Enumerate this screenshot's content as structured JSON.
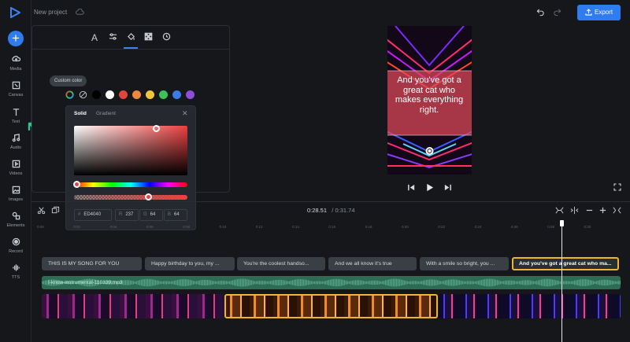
{
  "header": {
    "project_title": "New project",
    "export_label": "Export"
  },
  "rail": {
    "items": [
      {
        "label": "Media",
        "icon": "media-icon"
      },
      {
        "label": "Canvas",
        "icon": "canvas-icon"
      },
      {
        "label": "Text",
        "icon": "text-icon"
      },
      {
        "label": "Audio",
        "icon": "audio-icon"
      },
      {
        "label": "Videos",
        "icon": "videos-icon"
      },
      {
        "label": "Images",
        "icon": "images-icon"
      },
      {
        "label": "Elements",
        "icon": "elements-icon"
      },
      {
        "label": "Record",
        "icon": "record-icon"
      },
      {
        "label": "TTS",
        "icon": "tts-icon"
      }
    ]
  },
  "panel": {
    "tooltip": "Custom color",
    "swatches": [
      "#000000",
      "#ffffff",
      "#e0463c",
      "#e98a3f",
      "#f0c53a",
      "#3fbf5a",
      "#3b7be8",
      "#8e4fd6"
    ],
    "picker": {
      "tab_solid": "Solid",
      "tab_gradient": "Gradient",
      "hex_label": "#",
      "hex": "ED4040",
      "r_label": "R",
      "r": "237",
      "g_label": "G",
      "g": "64",
      "b_label": "B",
      "b": "64",
      "color": "#ed4040"
    }
  },
  "preview": {
    "caption": "And you've got a great cat who makes everything right."
  },
  "timeline": {
    "current_time": "0:28.51",
    "total_time": "/ 0:31.74",
    "ruler": [
      "0:00",
      "0:02",
      "0:04",
      "0:06",
      "0:08",
      "0:10",
      "0:12",
      "0:14",
      "0:16",
      "0:18",
      "0:20",
      "0:22",
      "0:24",
      "0:26",
      "0:28",
      "0:30"
    ],
    "text_clips": [
      "THIS IS MY SONG FOR YOU",
      "Happy birthday to you, my ...",
      "You're the coolest handso...",
      "And we all know it's true",
      "With a smile so bright, you ...",
      "And you've got a great cat who ma..."
    ],
    "audio_clip": "I-know-instrumental-110339.mp3"
  }
}
